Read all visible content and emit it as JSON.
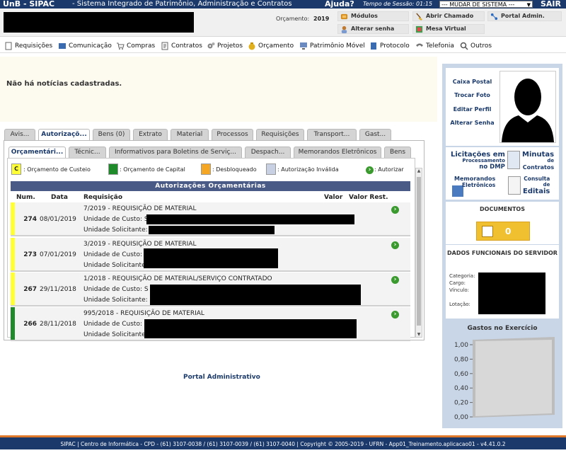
{
  "topbar": {
    "app_title": "UnB - SIPAC",
    "app_subtitle": "- Sistema Integrado de Patrimônio, Administração e Contratos",
    "help": "Ajuda?",
    "session": "Tempo de Sessão: 01:15",
    "system_select": "--- MUDAR DE SISTEMA ---",
    "logout": "SAIR"
  },
  "header": {
    "budget_label": "Orçamento:",
    "budget_year": "2019",
    "links": {
      "modulos": "Módulos",
      "abrir_chamado": "Abrir Chamado",
      "portal_admin": "Portal Admin.",
      "alterar_senha": "Alterar senha",
      "mesa_virtual": "Mesa Virtual"
    }
  },
  "menu": {
    "requisicoes": "Requisições",
    "comunicacao": "Comunicação",
    "compras": "Compras",
    "contratos": "Contratos",
    "projetos": "Projetos",
    "orcamento": "Orçamento",
    "patrimonio": "Patrimônio Móvel",
    "protocolo": "Protocolo",
    "telefonia": "Telefonia",
    "outros": "Outros"
  },
  "news": {
    "text": "Não há notícias cadastradas."
  },
  "tabs": {
    "avisos": "Avis...",
    "autorizacoes": "Autorizaçõ...",
    "bens": "Bens (0)",
    "extrato": "Extrato",
    "material": "Material",
    "processos": "Processos",
    "requisicoes": "Requisições",
    "transporte": "Transport...",
    "gastos": "Gast..."
  },
  "subtabs": {
    "orcamentarias": "Orçamentári...",
    "tecnicos": "Técnic...",
    "informativos": "Informativos para Boletins de Serviç...",
    "despachos": "Despach...",
    "memorandos": "Memorandos Eletrônicos",
    "bens": "Bens"
  },
  "legend": {
    "custeio_letter": "C",
    "custeio": ": Orçamento de Custeio",
    "capital": ": Orçamento de Capital",
    "desbloqueado": ": Desbloqueado",
    "invalida": ": Autorização Inválida",
    "autorizar": ": Autorizar",
    "colors": {
      "custeio": "#ffff33",
      "capital": "#1e8a2a",
      "desbloqueado": "#f5a623",
      "invalida": "#c8d0e4"
    }
  },
  "table": {
    "title": "Autorizações Orçamentárias",
    "headers": {
      "num": "Num.",
      "data": "Data",
      "requisicao": "Requisição",
      "valor": "Valor",
      "valor_rest": "Valor Rest."
    },
    "uc_label": "Unidade de Custo:",
    "us_label": "Unidade Solicitante:",
    "rows": [
      {
        "num": "274",
        "date": "08/01/2019",
        "req": "7/2019 - REQUISIÇÃO DE MATERIAL",
        "uc_prefix": "S",
        "type": "custeio"
      },
      {
        "num": "273",
        "date": "07/01/2019",
        "req": "3/2019 - REQUISIÇÃO DE MATERIAL",
        "uc_prefix": "",
        "type": "custeio"
      },
      {
        "num": "267",
        "date": "29/11/2018",
        "req": "1/2018 - REQUISIÇÃO DE MATERIAL/SERVIÇO CONTRATADO",
        "uc_prefix": "S",
        "type": "custeio"
      },
      {
        "num": "266",
        "date": "28/11/2018",
        "req": "995/2018 - REQUISIÇÃO DE MATERIAL",
        "uc_prefix": "",
        "type": "capital"
      }
    ]
  },
  "portal_link": "Portal Administrativo",
  "profile": {
    "caixa_postal": "Caixa Postal",
    "trocar_foto": "Trocar Foto",
    "editar_perfil": "Editar Perfil",
    "alterar_senha": "Alterar Senha"
  },
  "shortcuts": {
    "licitacoes": [
      "Licitações em",
      "Processamento",
      "no DMP"
    ],
    "minutas": [
      "Minutas",
      "de",
      "Contratos"
    ],
    "memorandos": [
      "Memorandos",
      "Eletrônicos"
    ],
    "editais": [
      "Consulta",
      "de",
      "Editais"
    ]
  },
  "documents": {
    "title": "DOCUMENTOS",
    "count": "0"
  },
  "dados_funcionais": {
    "title": "DADOS FUNCIONAIS DO SERVIDOR",
    "categoria": "Categoria:",
    "cargo": "Cargo:",
    "vinculo": "Vínculo:",
    "lotacao": "Lotação:"
  },
  "gastos": {
    "title": "Gastos no Exercício",
    "ticks": [
      "1,00",
      "0,80",
      "0,60",
      "0,40",
      "0,20",
      "0,00"
    ]
  },
  "footer": "SIPAC | Centro de Informática - CPD - (61) 3107-0038 / (61) 3107-0039 / (61) 3107-0040 | Copyright © 2005-2019 - UFRN - App01_Treinamento.aplicacao01 - v4.41.0.2"
}
